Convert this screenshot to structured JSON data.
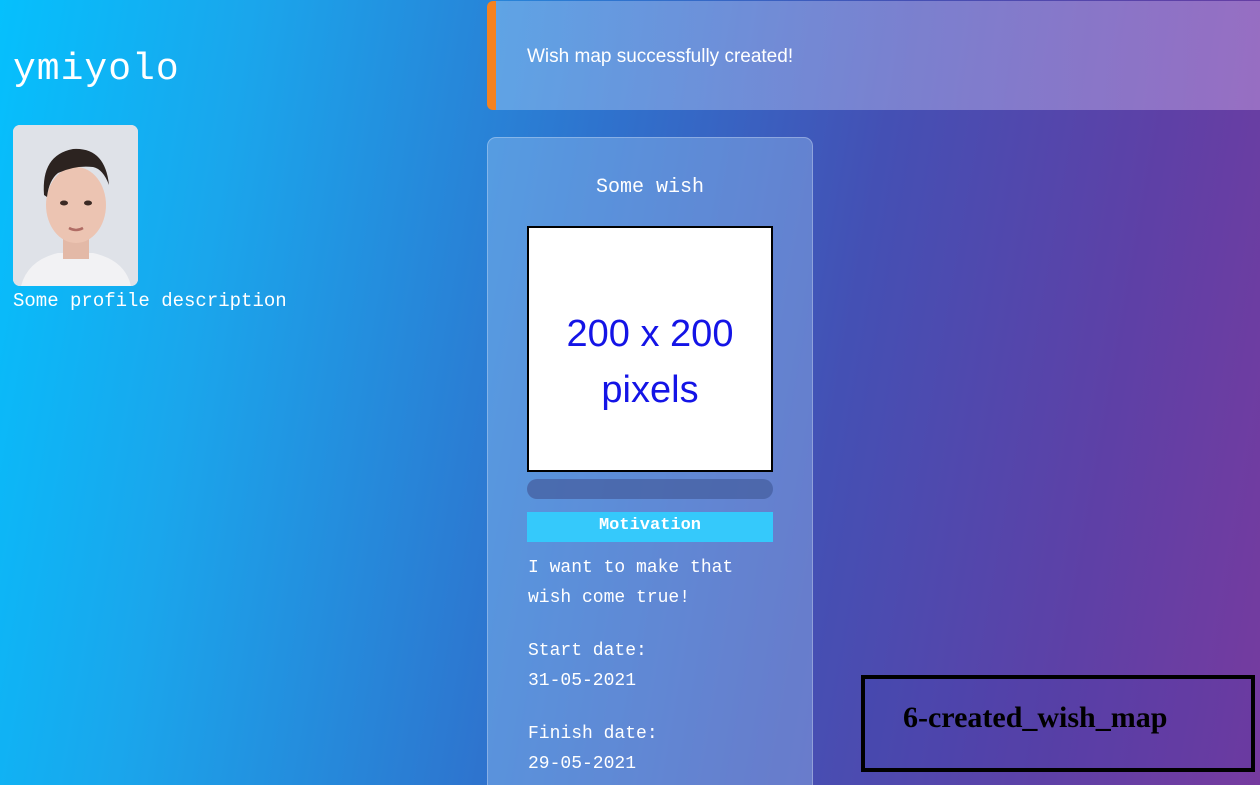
{
  "profile": {
    "name": "ymiyolo",
    "description": "Some profile description"
  },
  "notification": {
    "message": "Wish map successfully created!",
    "accent_color": "#f5821f"
  },
  "wish": {
    "title": "Some wish",
    "image_placeholder": "200 x 200\npixels",
    "progress_percent": 0,
    "motivation_label": "Motivation",
    "motivation_text": "I want to make that wish come true!",
    "start_date_label": "Start date:",
    "start_date": "31-05-2021",
    "finish_date_label": "Finish date:",
    "finish_date": "29-05-2021"
  },
  "caption": "6-created_wish_map",
  "colors": {
    "motivation_bg": "#35c9fb",
    "image_text": "#1414e6"
  }
}
